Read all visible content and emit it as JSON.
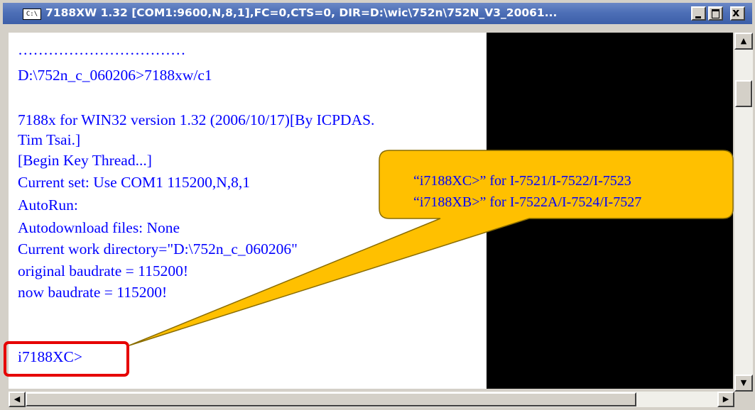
{
  "window": {
    "title": "7188XW 1.32 [COM1:9600,N,8,1],FC=0,CTS=0, DIR=D:\\wic\\752n\\752N_V3_20061...",
    "icon_label": "C:\\",
    "icon": "console-icon",
    "controls": {
      "minimize": "minimize-icon",
      "maximize": "maximize-icon",
      "close": "x"
    }
  },
  "console": {
    "lines": [
      "……………………………",
      "D:\\752n_c_060206>7188xw/c1",
      "",
      "7188x for WIN32 version 1.32 (2006/10/17)[By ICPDAS.",
      "Tim Tsai.]",
      "[Begin Key Thread...]",
      "Current set: Use COM1 115200,N,8,1",
      "AutoRun:",
      "Autodownload files: None",
      "Current work directory=\"D:\\752n_c_060206\"",
      "original baudrate = 115200!",
      "now baudrate = 115200!"
    ],
    "prompt": "i7188XC>"
  },
  "callout": {
    "line1": "“i7188XC>” for I-7521/I-7522/I-7523",
    "line2": "“i7188XB>” for I-7522A/I-7524/I-7527",
    "fill": "#ffc000",
    "highlight_color": "#e60000"
  },
  "scrollbars": {
    "up": "▲",
    "down": "▼",
    "left": "◀",
    "right": "▶"
  }
}
